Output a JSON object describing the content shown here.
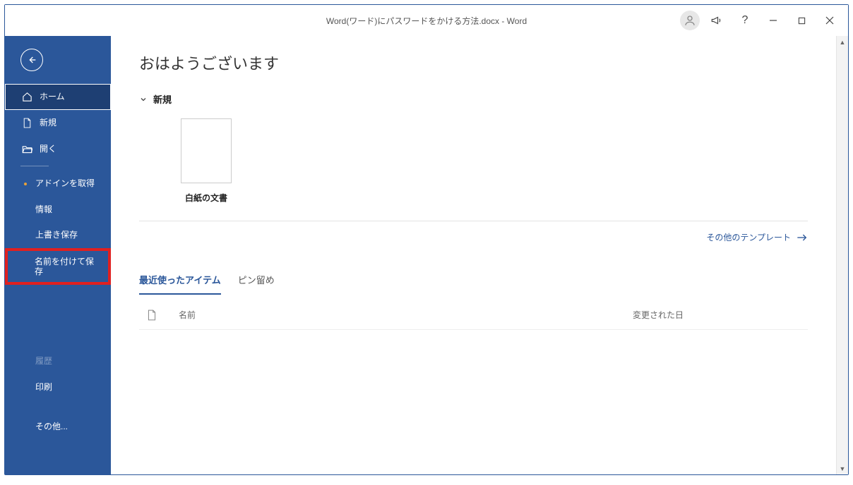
{
  "titlebar": {
    "title": "Word(ワード)にパスワードをかける方法.docx  -  Word"
  },
  "sidebar": {
    "home": "ホーム",
    "new": "新規",
    "open": "開く",
    "get_addins": "アドインを取得",
    "info": "情報",
    "save": "上書き保存",
    "save_as": "名前を付けて保存",
    "history": "履歴",
    "print": "印刷",
    "more": "その他..."
  },
  "main": {
    "greeting": "おはようございます",
    "new_section": "新規",
    "templates": [
      {
        "label": "白紙の文書"
      }
    ],
    "more_templates": "その他のテンプレート",
    "tabs": {
      "recent": "最近使ったアイテム",
      "pinned": "ピン留め"
    },
    "list": {
      "col_name": "名前",
      "col_date": "変更された日"
    }
  }
}
